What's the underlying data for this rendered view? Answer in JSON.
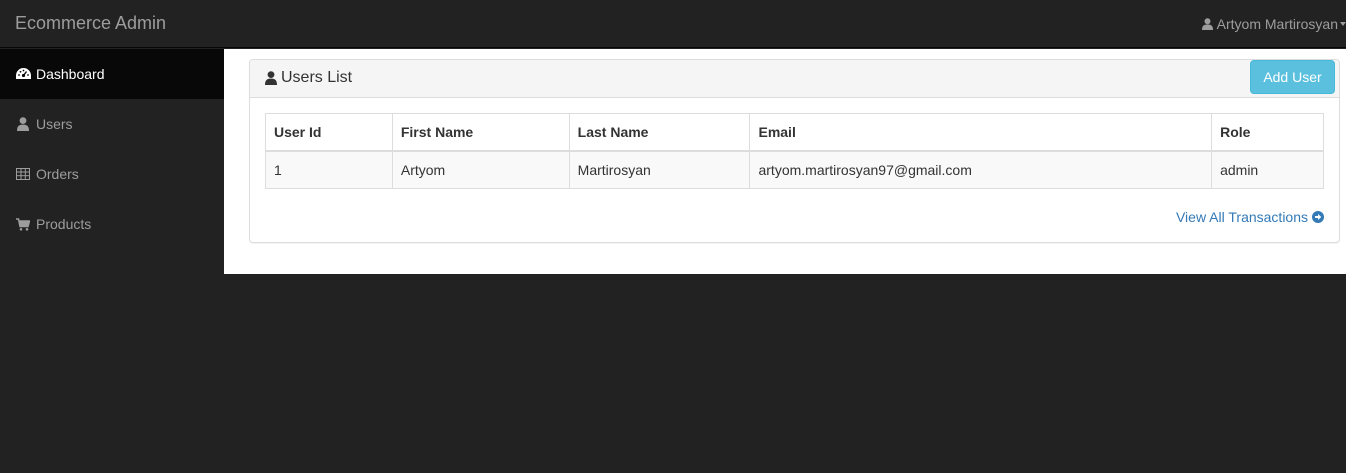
{
  "navbar": {
    "brand": "Ecommerce Admin",
    "user_name": "Artyom Martirosyan",
    "user_icon": "user-icon"
  },
  "sidebar": {
    "items": [
      {
        "label": "Dashboard",
        "icon": "dashboard-icon",
        "active": true
      },
      {
        "label": "Users",
        "icon": "user-icon",
        "active": false
      },
      {
        "label": "Orders",
        "icon": "table-icon",
        "active": false
      },
      {
        "label": "Products",
        "icon": "shopping-cart-icon",
        "active": false
      }
    ]
  },
  "panel": {
    "title": "Users List",
    "title_icon": "user-icon",
    "add_button": "Add User",
    "view_all": "View All Transactions",
    "view_all_icon": "arrow-circle-right-icon"
  },
  "table": {
    "headers": [
      "User Id",
      "First Name",
      "Last Name",
      "Email",
      "Role"
    ],
    "rows": [
      [
        "1",
        "Artyom",
        "Martirosyan",
        "artyom.martirosyan97@gmail.com",
        "admin"
      ]
    ]
  },
  "colors": {
    "navbar_bg": "#222222",
    "active_item_bg": "#080808",
    "button_info": "#5bc0de",
    "link": "#337ab7"
  }
}
